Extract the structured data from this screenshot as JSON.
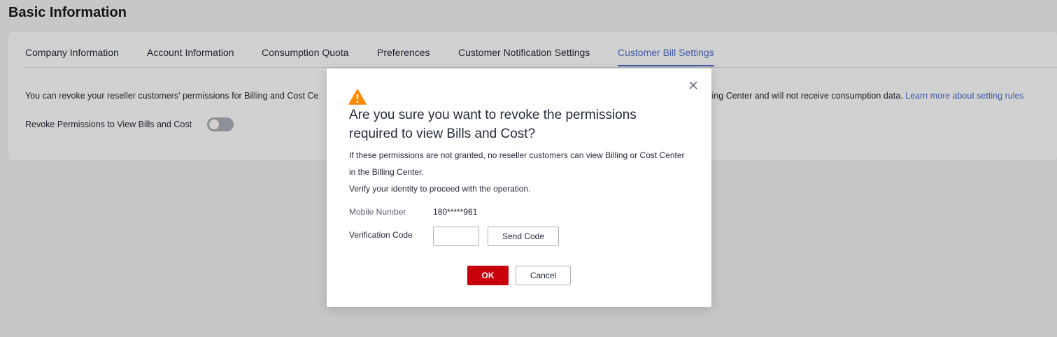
{
  "page": {
    "title": "Basic Information"
  },
  "tabs": [
    {
      "label": "Company Information"
    },
    {
      "label": "Account Information"
    },
    {
      "label": "Consumption Quota"
    },
    {
      "label": "Preferences"
    },
    {
      "label": "Customer Notification Settings"
    },
    {
      "label": "Customer Bill Settings",
      "active": true
    }
  ],
  "settings": {
    "description_start": "You can revoke your reseller customers' permissions for Billing and Cost Ce",
    "description_end": "lling Center and will not receive consumption data.",
    "learn_more_link": "Learn more about setting rules",
    "revoke_label": "Revoke Permissions to View Bills and Cost",
    "revoke_enabled": false
  },
  "dialog": {
    "title": "Are you sure you want to revoke the permissions required to view Bills and Cost?",
    "message_line1": "If these permissions are not granted, no reseller customers can view Billing or Cost Center",
    "message_line2": "in the Billing Center.",
    "message_line3": "Verify your identity to proceed with the operation.",
    "mobile_label": "Mobile Number",
    "mobile_value": "180*****961",
    "code_label": "Verification Code",
    "code_value": "",
    "send_code_label": "Send Code",
    "ok_label": "OK",
    "cancel_label": "Cancel",
    "icons": {
      "warning": "warning-icon",
      "close": "close-icon"
    }
  },
  "colors": {
    "accent": "#526ecc",
    "danger": "#c7000b",
    "warning": "#ff8800"
  }
}
